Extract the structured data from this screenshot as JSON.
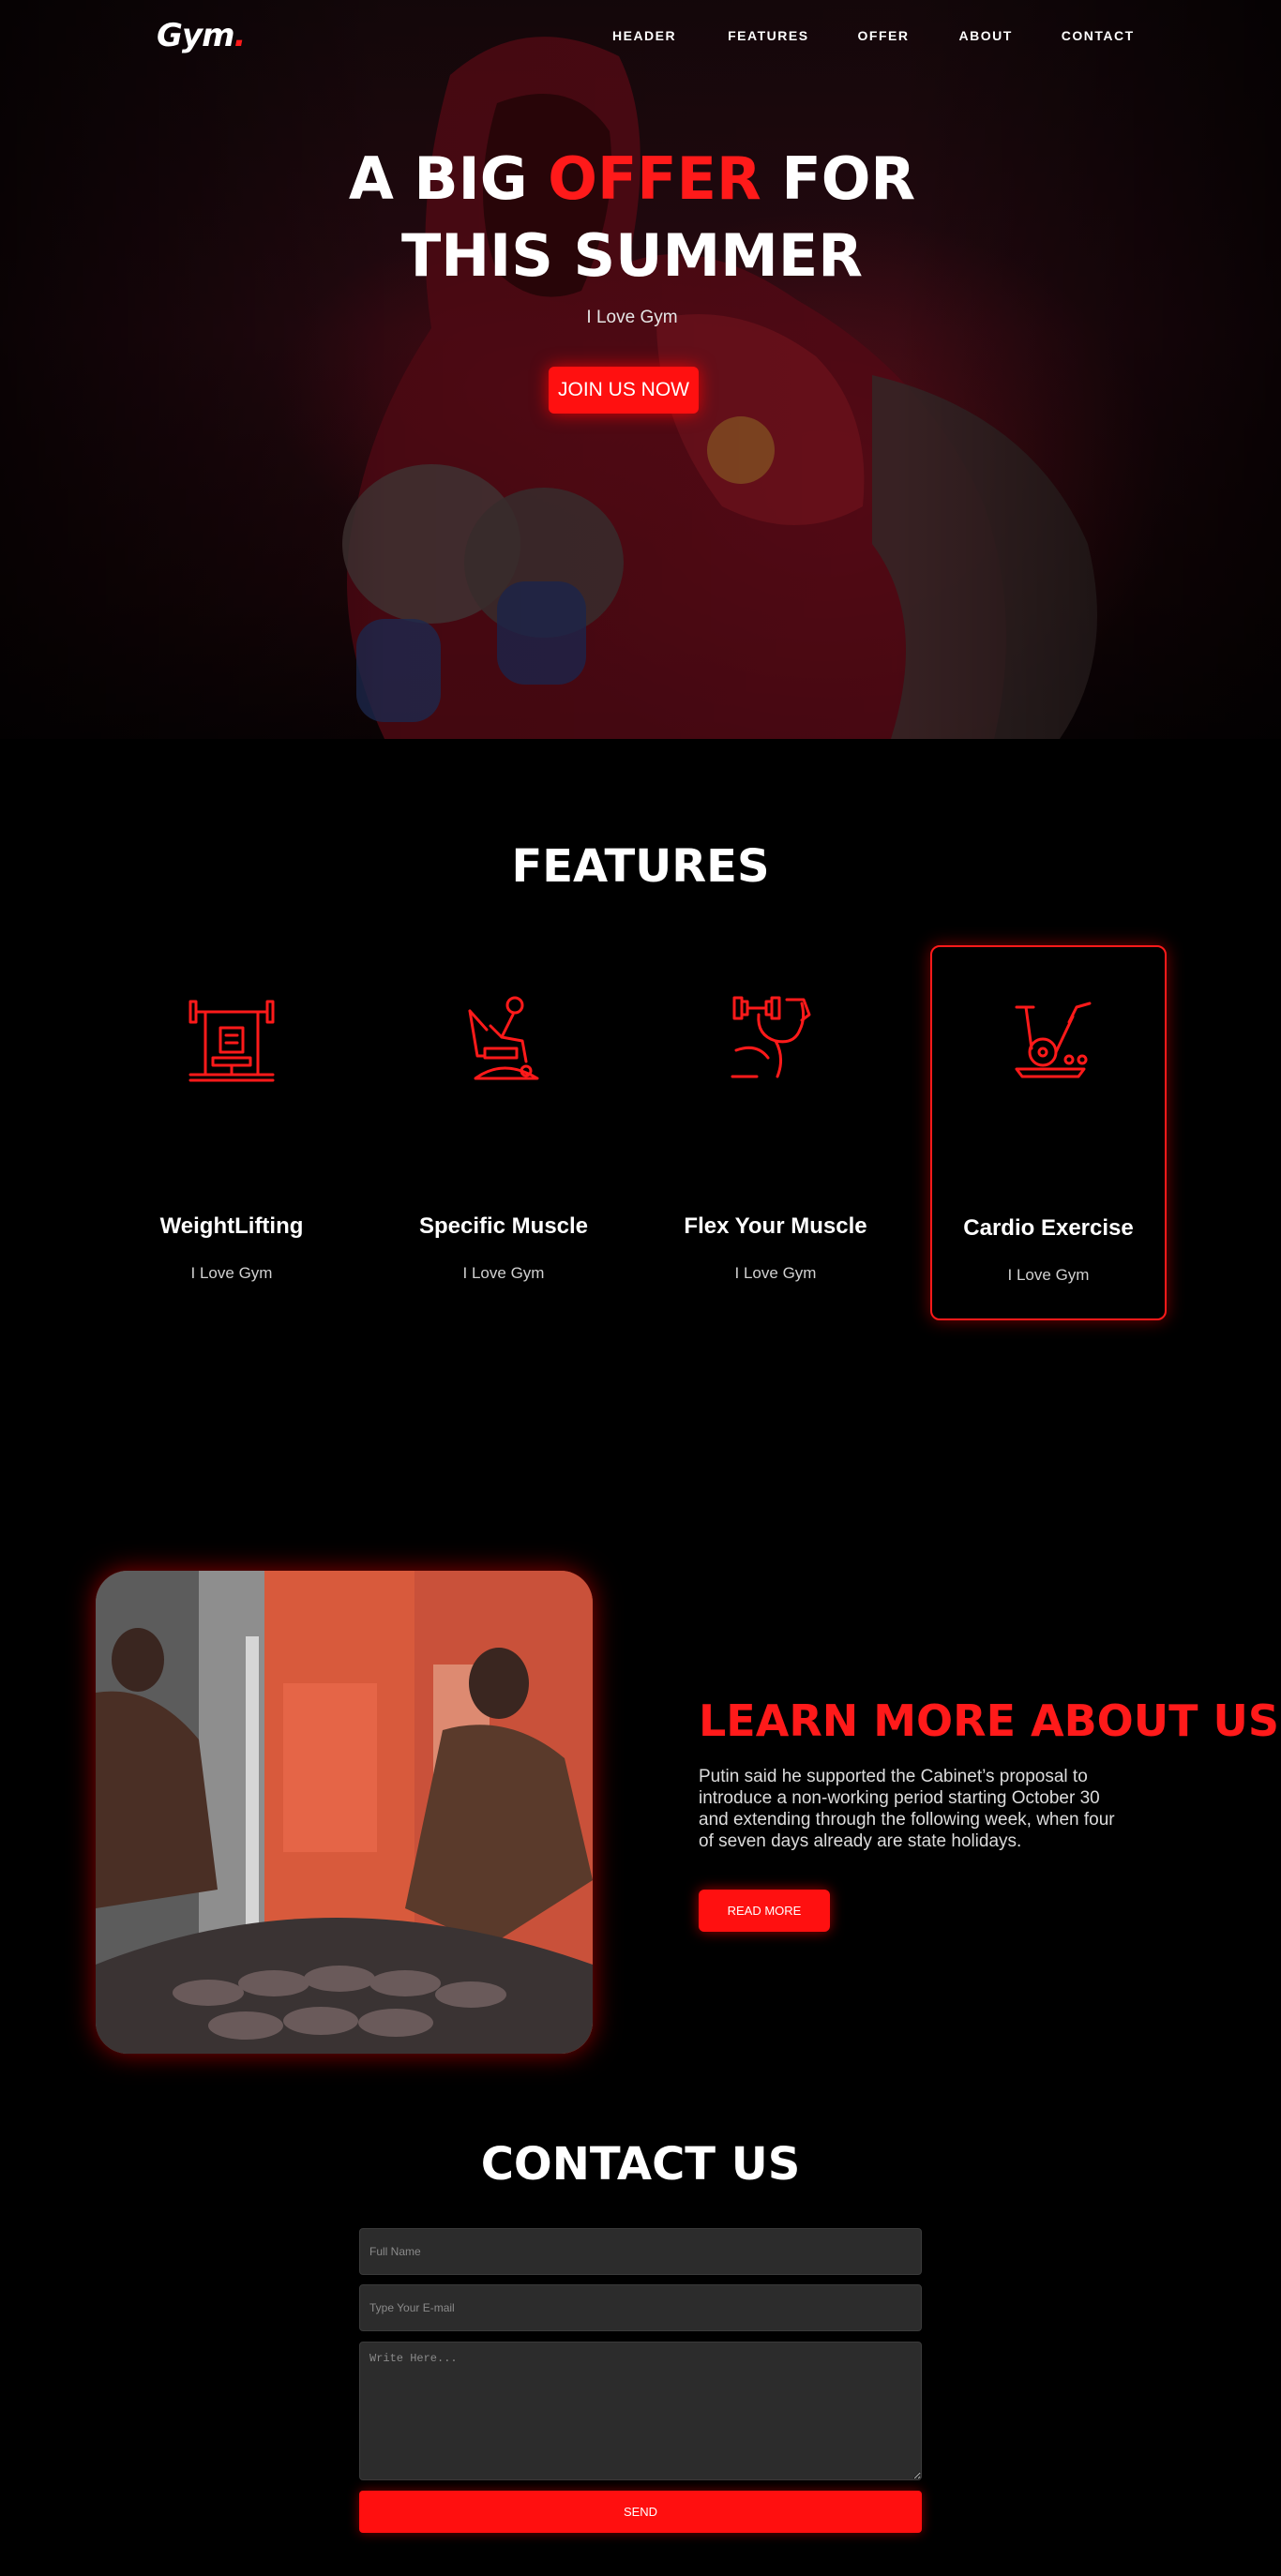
{
  "header": {
    "logo_text": "Gym",
    "logo_dot": ".",
    "nav": [
      "HEADER",
      "FEATURES",
      "OFFER",
      "ABOUT",
      "CONTACT"
    ]
  },
  "hero": {
    "title_part1": "A BIG ",
    "title_accent": "OFFER",
    "title_part2": " FOR",
    "title_line2": "THIS SUMMER",
    "subtitle": "I Love Gym",
    "cta_label": "JOIN US NOW"
  },
  "features": {
    "title": "FEATURES",
    "items": [
      {
        "name": "WeightLifting",
        "subtitle": "I Love Gym",
        "icon": "weightlifting-bench-icon"
      },
      {
        "name": "Specific Muscle",
        "subtitle": "I Love Gym",
        "icon": "exercise-machine-icon"
      },
      {
        "name": "Flex Your Muscle",
        "subtitle": "I Love Gym",
        "icon": "flexing-arm-icon"
      },
      {
        "name": "Cardio Exercise",
        "subtitle": "I Love Gym",
        "icon": "exercise-bike-icon"
      }
    ]
  },
  "about": {
    "title": "LEARN MORE ABOUT US",
    "text": "Putin said he supported the Cabinet’s proposal to introduce a non-working period starting October 30 and extending through the following week, when four of seven days already are state holidays.",
    "button_label": "READ MORE"
  },
  "contact": {
    "title": "CONTACT US",
    "name_placeholder": "Full Name",
    "email_placeholder": "Type Your E-mail",
    "message_placeholder": "Write Here...",
    "send_label": "SEND"
  },
  "colors": {
    "accent": "#ff1a1a",
    "background": "#000000",
    "field_bg": "#2c2c2c"
  }
}
